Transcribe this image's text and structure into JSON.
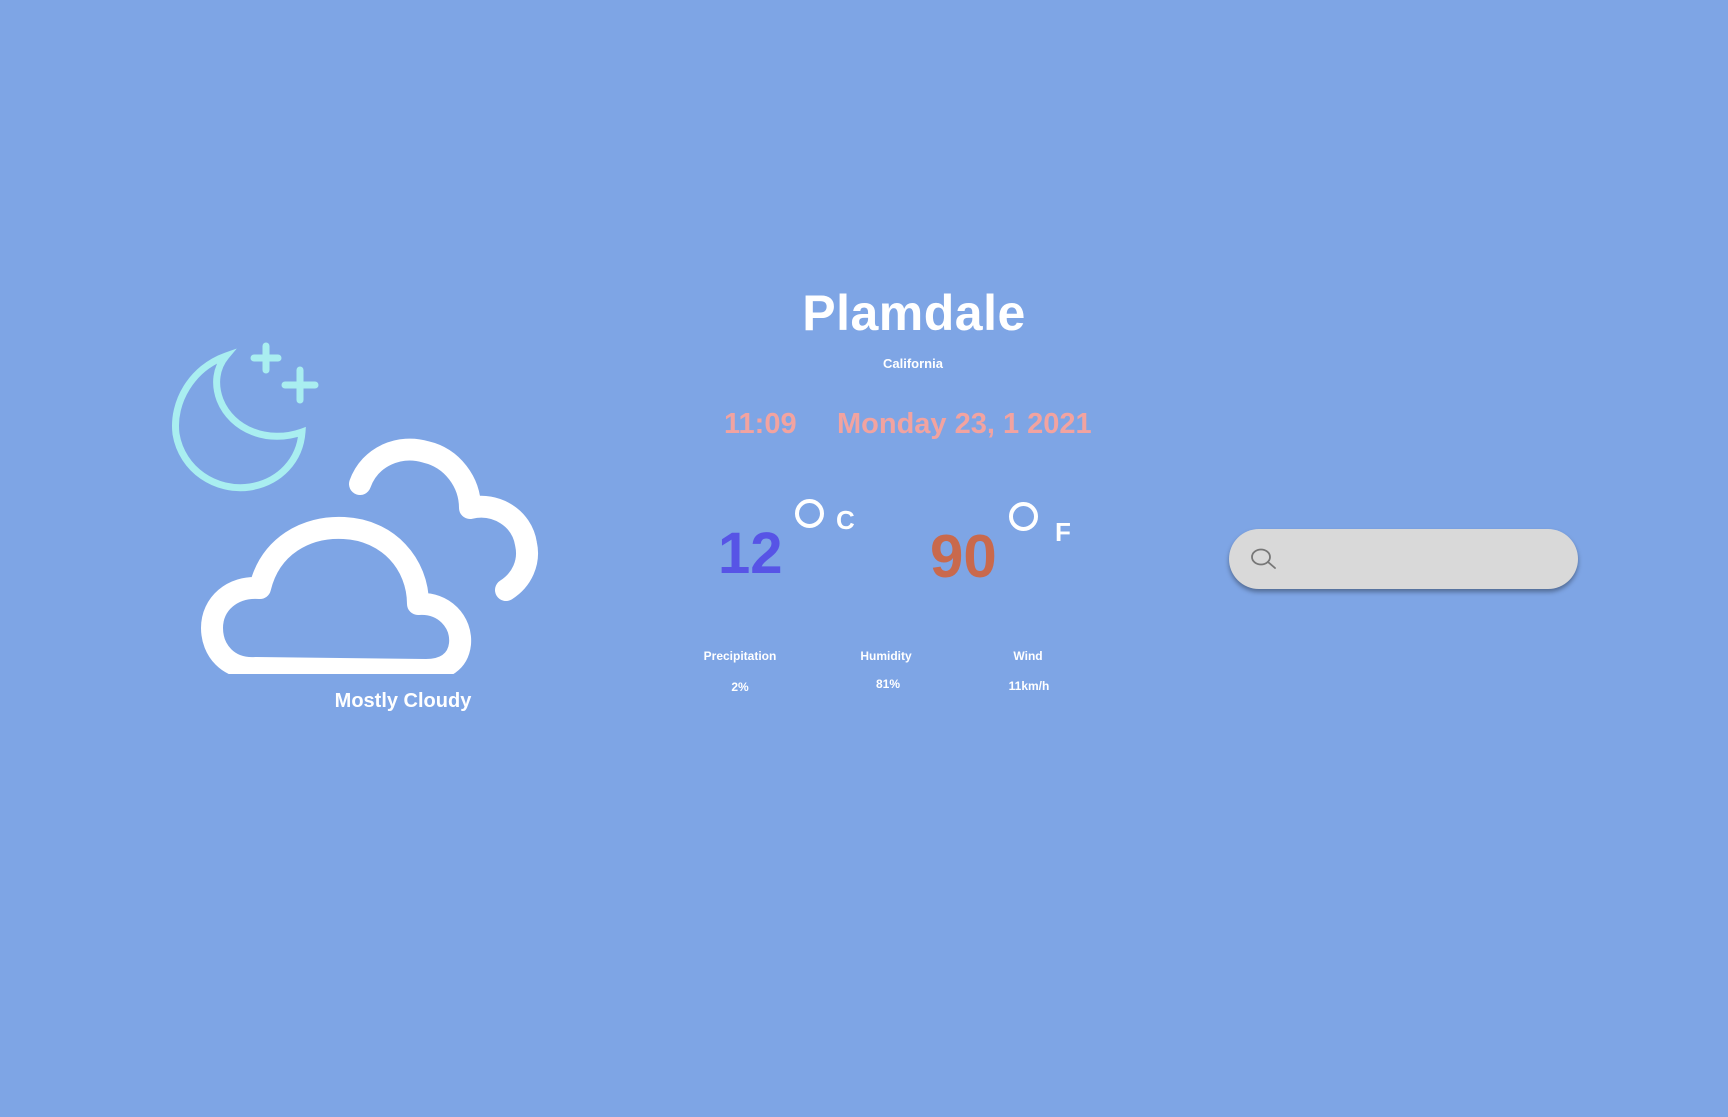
{
  "location": {
    "city": "Plamdale",
    "state": "California"
  },
  "datetime": {
    "time": "11:09",
    "date": "Monday 23, 1 2021"
  },
  "temperature": {
    "celsius": "12",
    "celsius_unit": "C",
    "fahrenheit": "90",
    "fahrenheit_unit": "F"
  },
  "condition": {
    "label": "Mostly Cloudy",
    "icon": "night-cloudy-icon"
  },
  "stats": {
    "precipitation_label": "Precipitation",
    "precipitation_value": "2%",
    "humidity_label": "Humidity",
    "humidity_value": "81%",
    "wind_label": "Wind",
    "wind_value": "11km/h"
  },
  "search": {
    "placeholder": "",
    "value": ""
  },
  "colors": {
    "background": "#7ea5e5",
    "moon": "#a9eef0",
    "cloud": "#ffffff",
    "time_date": "#f2a3a0",
    "celsius": "#5754e6",
    "fahrenheit": "#c9694c",
    "search_bg": "#d9d9d9"
  }
}
